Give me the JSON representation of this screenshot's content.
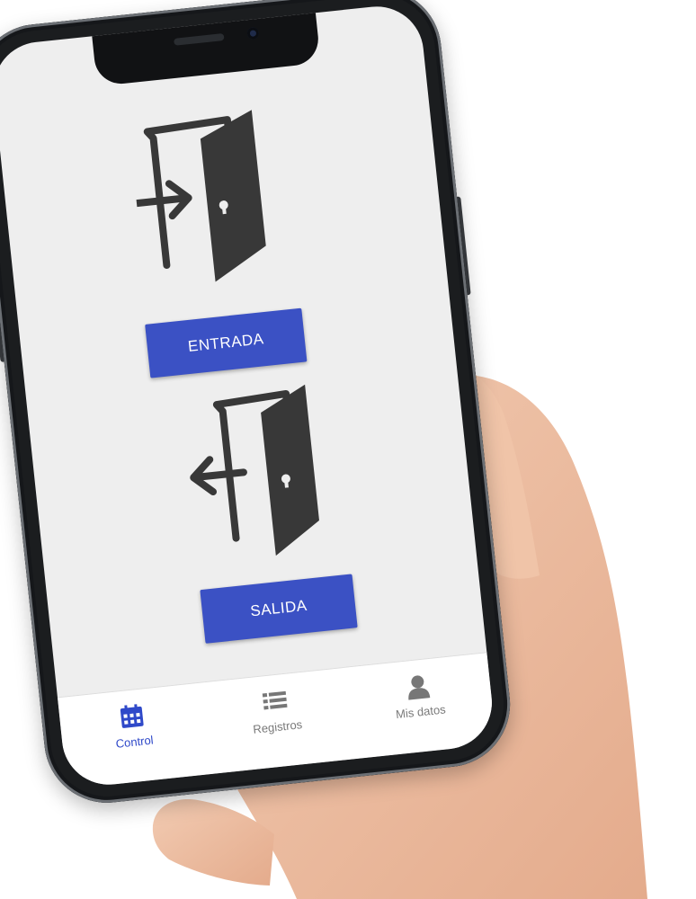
{
  "app": {
    "entry_button_label": "ENTRADA",
    "exit_button_label": "SALIDA"
  },
  "tab_bar": {
    "tabs": [
      {
        "label": "Control",
        "icon": "calendar-icon",
        "active": true
      },
      {
        "label": "Registros",
        "icon": "list-icon",
        "active": false
      },
      {
        "label": "Mis datos",
        "icon": "user-icon",
        "active": false
      }
    ]
  },
  "colors": {
    "accent": "#3b51c4",
    "screen_background": "#eeeeee",
    "icon": "#383838",
    "active_tab": "#2f49c9",
    "inactive_tab": "#7a7a7a"
  }
}
